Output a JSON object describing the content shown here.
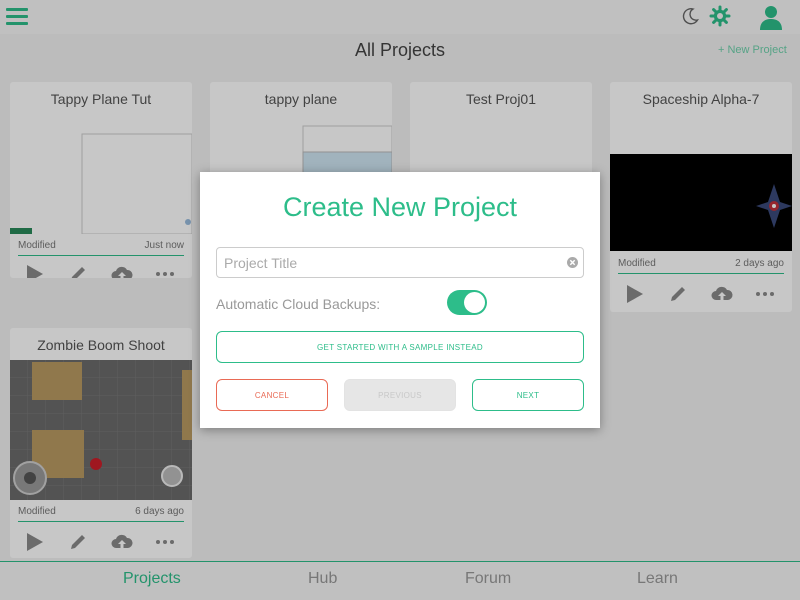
{
  "header": {
    "menu_icon": "hamburger-icon",
    "night_mode_icon": "moon-icon",
    "settings_icon": "gear-icon",
    "account_icon": "user-icon",
    "page_title": "All Projects",
    "new_project_label": "+ New Project"
  },
  "projects": [
    {
      "title": "Tappy Plane Tut",
      "modified_label": "Modified",
      "modified": "Just now"
    },
    {
      "title": "tappy plane",
      "modified_label": "",
      "modified": ""
    },
    {
      "title": "Test Proj01",
      "modified_label": "",
      "modified": ""
    },
    {
      "title": "Spaceship Alpha-7",
      "modified_label": "Modified",
      "modified": "2 days ago"
    },
    {
      "title": "Zombie Boom Shoot",
      "modified_label": "Modified",
      "modified": "6 days ago"
    }
  ],
  "card_actions": [
    "play-icon",
    "pencil-icon",
    "cloud-upload-icon",
    "more-icon"
  ],
  "tabs": [
    {
      "label": "Projects",
      "active": true
    },
    {
      "label": "Hub",
      "active": false
    },
    {
      "label": "Forum",
      "active": false
    },
    {
      "label": "Learn",
      "active": false
    }
  ],
  "modal": {
    "title": "Create New Project",
    "title_placeholder": "Project Title",
    "title_value": "",
    "backup_label": "Automatic Cloud Backups:",
    "backup_enabled": true,
    "sample_label": "GET STARTED WITH A SAMPLE INSTEAD",
    "cancel_label": "CANCEL",
    "previous_label": "PREVIOUS",
    "next_label": "NEXT"
  },
  "colors": {
    "accent": "#2dbd8a",
    "cancel": "#e96a55",
    "disabled": "#e6e6e6"
  }
}
